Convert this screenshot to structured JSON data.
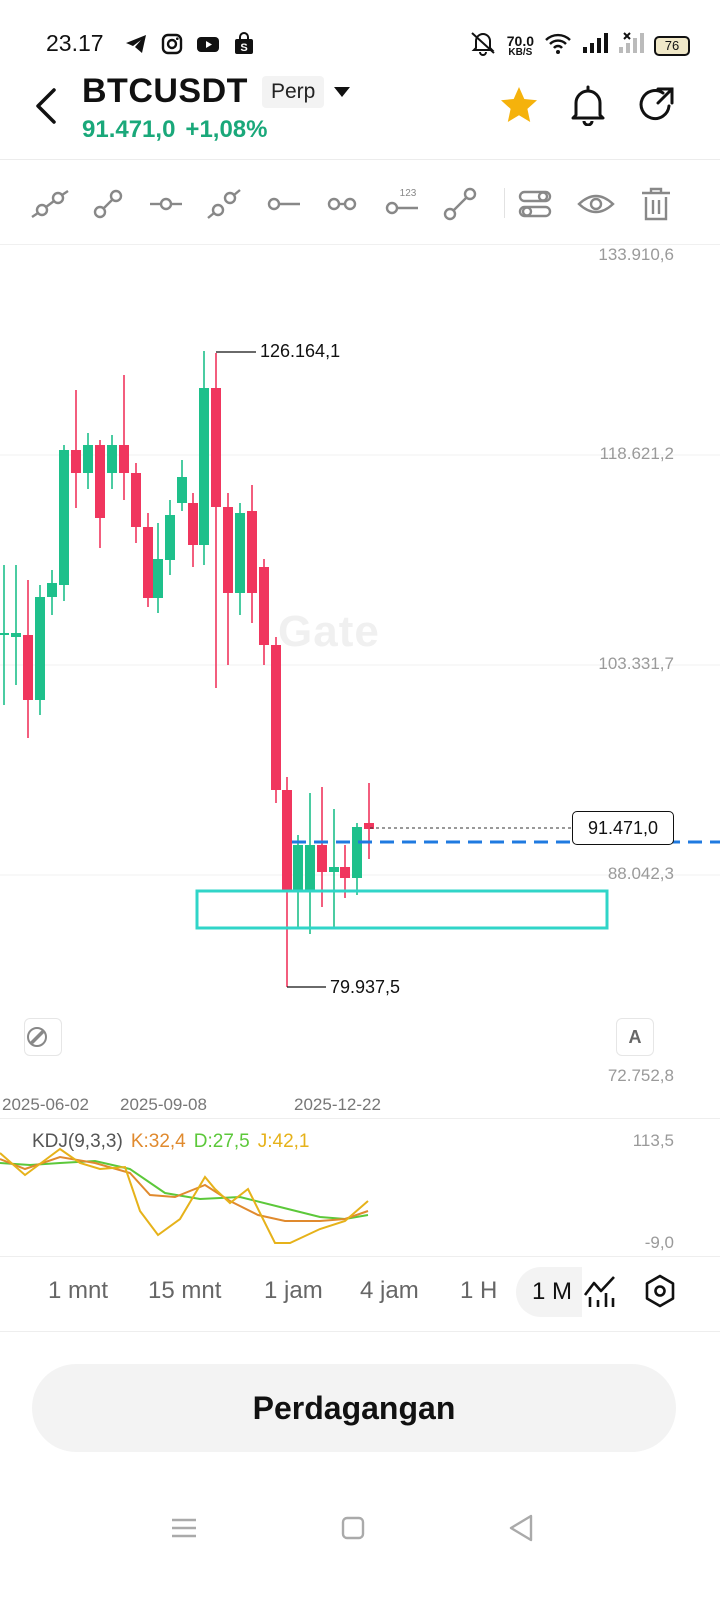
{
  "status": {
    "time": "23.17",
    "net_speed_value": "70.0",
    "net_speed_unit": "KB/S",
    "battery": "76"
  },
  "header": {
    "symbol": "BTCUSDT",
    "contract_type": "Perp",
    "last_price": "91.471,0",
    "change_pct": "+1,08%"
  },
  "chart": {
    "watermark": "Gate",
    "price_axis": [
      "133.910,6",
      "118.621,2",
      "103.331,7",
      "88.042,3",
      "72.752,8"
    ],
    "high_label": "126.164,1",
    "low_label": "79.937,5",
    "current_price_tag": "91.471,0",
    "date_labels": [
      "2025-06-02",
      "2025-09-08",
      "2025-12-22"
    ],
    "auto_button": "A",
    "colors": {
      "up": "#1ec08b",
      "down": "#f0365e",
      "price_line": "#1f7ae0",
      "zone": "#30d5c8"
    }
  },
  "kdj": {
    "name": "KDJ(9,3,3)",
    "k": "K:32,4",
    "d": "D:27,5",
    "j": "J:42,1",
    "axis_top": "113,5",
    "axis_bottom": "-9,0",
    "colors": {
      "k": "#e08a2e",
      "d": "#5cc83a",
      "j": "#e6b21a"
    }
  },
  "intervals": {
    "items": [
      "1 mnt",
      "15 mnt",
      "1 jam",
      "4 jam",
      "1 H"
    ],
    "active": "1 M"
  },
  "trade_button": "Perdagangan"
}
